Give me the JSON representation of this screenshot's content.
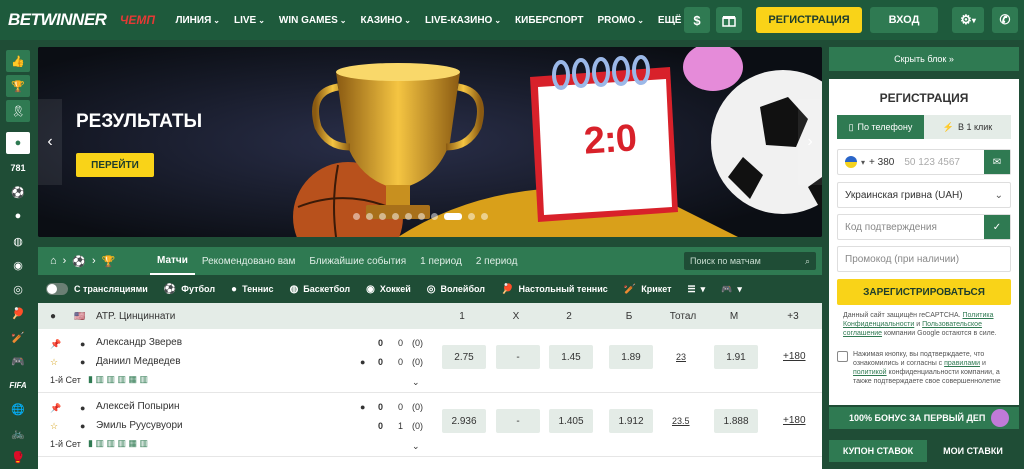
{
  "brand": {
    "part1": "BET",
    "part2": "WINNER",
    "badge": "ЧЕМП"
  },
  "nav": [
    {
      "label": "ЛИНИЯ",
      "chevron": true
    },
    {
      "label": "LIVE",
      "chevron": true
    },
    {
      "label": "WIN GAMES",
      "chevron": true
    },
    {
      "label": "КАЗИНО",
      "chevron": true
    },
    {
      "label": "LIVE-КАЗИНО",
      "chevron": true
    },
    {
      "label": "КИБЕРСПОРТ",
      "chevron": false
    },
    {
      "label": "PROMO",
      "chevron": true
    },
    {
      "label": "ЕЩЁ",
      "chevron": true
    }
  ],
  "top": {
    "register": "РЕГИСТРАЦИЯ",
    "login": "ВХОД",
    "dollar": "$"
  },
  "sidebar": {
    "count": "781"
  },
  "banner": {
    "title": "РЕЗУЛЬТАТЫ",
    "button": "ПЕРЕЙТИ",
    "score": "2:0"
  },
  "tabs": [
    "Матчи",
    "Рекомендовано вам",
    "Ближайшие события",
    "1 период",
    "2 период"
  ],
  "search_placeholder": "Поиск по матчам",
  "sports": {
    "broadcasts": "С трансляциями",
    "items": [
      "Футбол",
      "Теннис",
      "Баскетбол",
      "Хоккей",
      "Волейбол",
      "Настольный теннис",
      "Крикет"
    ]
  },
  "league": {
    "name": "ATP. Цинциннати",
    "cols": [
      "1",
      "X",
      "2",
      "Б",
      "Тотал",
      "М"
    ],
    "more": "+3"
  },
  "matches": [
    {
      "p1": "Александр Зверев",
      "p2": "Даниил Медведев",
      "s1": [
        "0",
        "0",
        "(0)"
      ],
      "s2": [
        "0",
        "0",
        "(0)"
      ],
      "set": "1-й Сет",
      "odds": [
        "2.75",
        "-",
        "1.45",
        "1.89",
        "23",
        "1.91"
      ],
      "more": "+180"
    },
    {
      "p1": "Алексей Попырин",
      "p2": "Эмиль Руусувуори",
      "s1": [
        "0",
        "0",
        "(0)"
      ],
      "s2": [
        "0",
        "1",
        "(0)"
      ],
      "set": "1-й Сет",
      "odds": [
        "2.936",
        "-",
        "1.405",
        "1.912",
        "23.5",
        "1.888"
      ],
      "more": "+180"
    }
  ],
  "right": {
    "hide": "Скрыть блок",
    "title": "РЕГИСТРАЦИЯ",
    "tab_phone": "По телефону",
    "tab_click": "В 1 клик",
    "phone_code": "+ 380",
    "phone_placeholder": "50 123 4567",
    "currency": "Украинская гривна (UAH)",
    "code_placeholder": "Код подтверждения",
    "promo_placeholder": "Промокод (при наличии)",
    "submit": "ЗАРЕГИСТРИРОВАТЬСЯ",
    "recaptcha_1": "Данный сайт защищён reCAPTCHA.",
    "recaptcha_link1": "Политика Конфиденциальности",
    "recaptcha_2": "и",
    "recaptcha_link2": "Пользовательское соглашение",
    "recaptcha_3": "компании Google остаются в силе.",
    "agree_1": "Нажимая кнопку, вы подтверждаете, что ознакомились и согласны с",
    "agree_link1": "правилами",
    "agree_2": "и",
    "agree_link2": "политикой",
    "agree_3": "конфиденциальности компании, а также подтверждаете свое совершеннолетие",
    "bonus": "100% БОНУС ЗА ПЕРВЫЙ ДЕП",
    "coupon": "КУПОН СТАВОК",
    "my_bets": "МОИ СТАВКИ"
  }
}
